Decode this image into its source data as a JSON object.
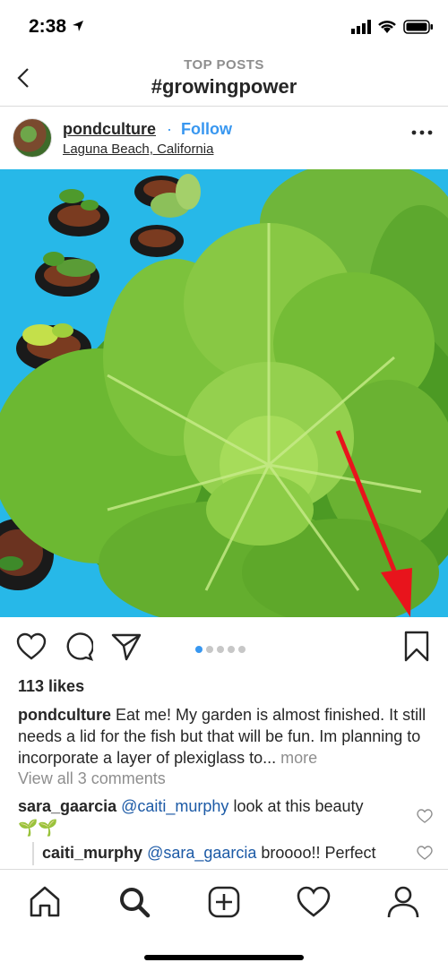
{
  "status_bar": {
    "time": "2:38"
  },
  "nav": {
    "subtitle": "TOP POSTS",
    "title": "#growingpower"
  },
  "post": {
    "username": "pondculture",
    "dot": "·",
    "follow": "Follow",
    "location": "Laguna Beach, California",
    "likes": "113 likes",
    "caption_user": "pondculture",
    "caption_text": " Eat me!  My garden is almost finished. It still needs a lid for the fish but that will be fun. Im planning to incorporate a layer of plexiglass to...",
    "caption_more": " more",
    "view_comments": "View all 3 comments",
    "comments": [
      {
        "user": "sara_gaarcia",
        "mention": "@caiti_murphy",
        "text": " look at this beauty",
        "emoji": "🌱🌱"
      },
      {
        "user": "caiti_murphy",
        "mention": "@sara_gaarcia",
        "text": " broooo!! Perfect"
      }
    ],
    "carousel": {
      "count": 5,
      "active": 0
    }
  },
  "colors": {
    "accent": "#3897f0",
    "text": "#262626",
    "muted": "#8e8e8e",
    "annotation_arrow": "#e8141c",
    "photo_bg": "#27b8e8"
  },
  "icons": [
    "location-arrow-icon",
    "signal-icon",
    "wifi-icon",
    "battery-icon",
    "back-chevron-icon",
    "more-dots-icon",
    "heart-icon",
    "comment-icon",
    "share-icon",
    "bookmark-icon",
    "home-icon",
    "search-icon",
    "add-post-icon",
    "activity-heart-icon",
    "profile-icon"
  ]
}
